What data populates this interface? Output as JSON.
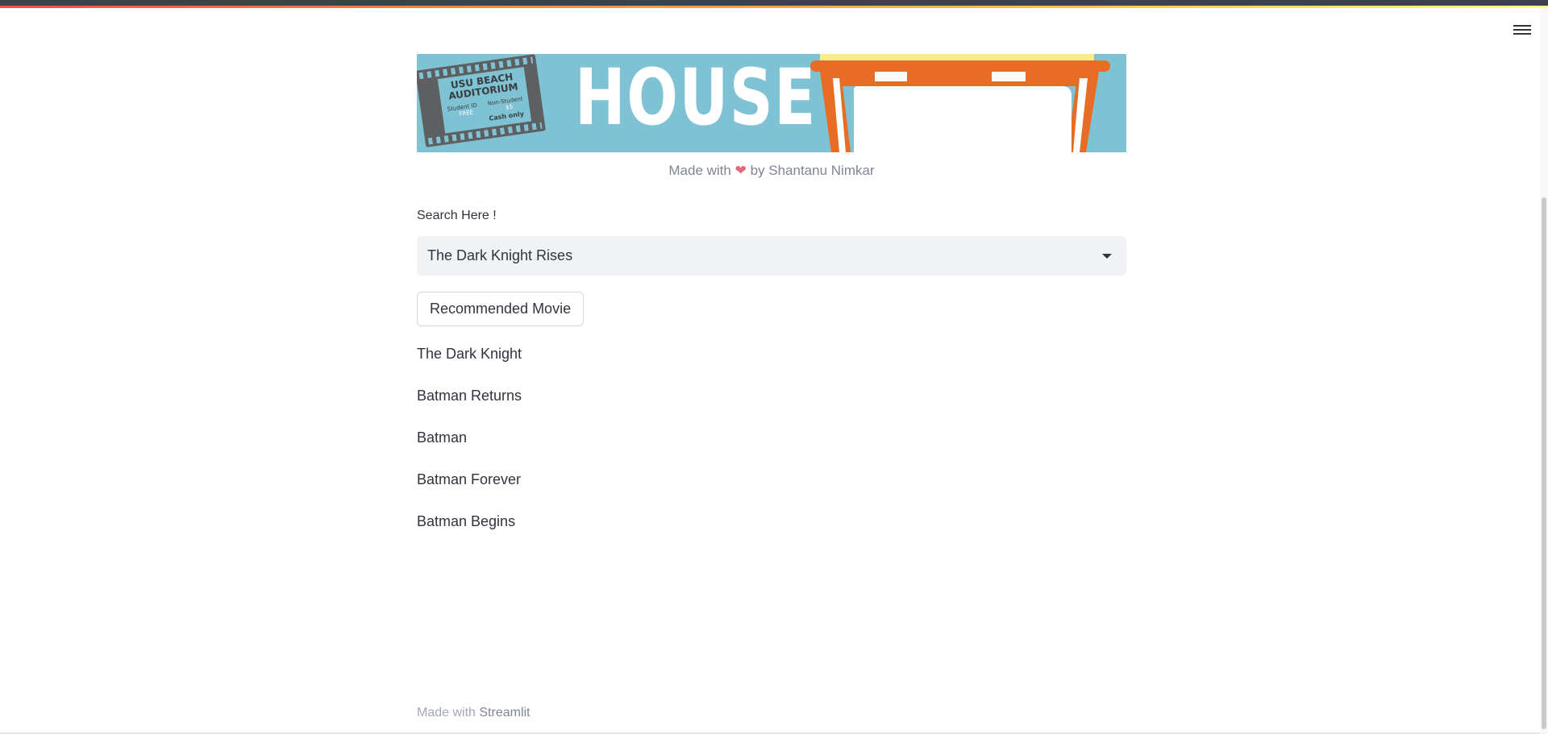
{
  "banner": {
    "heading": "HOUSE",
    "ticket": {
      "line1": "USU BEACH",
      "line2": "AUDITORIUM",
      "student_label": "Student ID",
      "student_price": "FREE",
      "nonstudent_label": "Non-Student",
      "nonstudent_price": "$5",
      "payment": "Cash only"
    }
  },
  "caption": {
    "prefix": "Made with",
    "heart": "❤",
    "suffix": "by Shantanu Nimkar"
  },
  "search": {
    "label": "Search Here !",
    "selected": "The Dark Knight Rises"
  },
  "action": {
    "button_label": "Recommended Movie"
  },
  "results": [
    "The Dark Knight",
    "Batman Returns",
    "Batman",
    "Batman Forever",
    "Batman Begins"
  ],
  "footer": {
    "prefix": "Made with",
    "brand": "Streamlit"
  },
  "colors": {
    "accent": "#ff4b4b",
    "banner_bg": "#7fc2d4",
    "popcorn_orange": "#e86d24"
  }
}
